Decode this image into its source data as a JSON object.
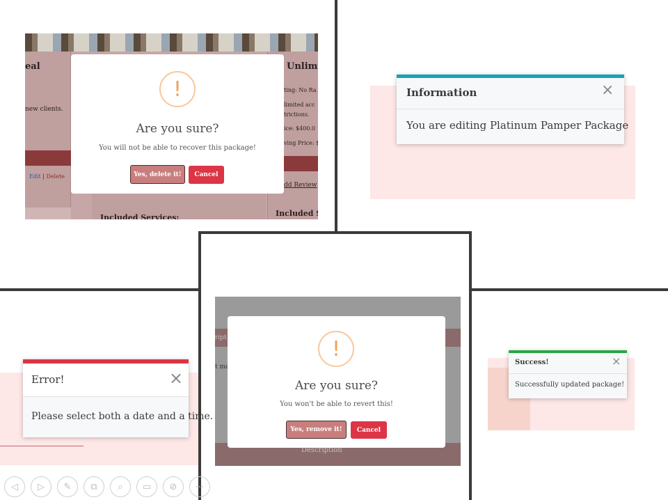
{
  "panel1": {
    "bg_left_heading": "eal",
    "bg_left_text": "new clients.",
    "bg_left_links": {
      "edit": "Edit",
      "sep": "|",
      "delete": "Delete"
    },
    "bg_right_heading": "Unlimi",
    "bg_right_lines": [
      "ting: No Ra",
      "limited acc",
      "trictions.",
      "ice: $400.0",
      "ving Price: $"
    ],
    "bg_right_link": "dd Review",
    "bg_right_section": "Included Se",
    "bg_middle_section": "Included Services:",
    "dialog": {
      "icon": "!",
      "title": "Are you sure?",
      "text": "You will not be able to recover this package!",
      "confirm": "Yes, delete it!",
      "cancel": "Cancel"
    }
  },
  "toast_info": {
    "title": "Information",
    "message": "You are editing Platinum Pamper Package",
    "close": "×",
    "accent": "#17a2b8"
  },
  "toast_error": {
    "title": "Error!",
    "message": "Please select both a date and a time.",
    "close": "×",
    "accent": "#dc3545"
  },
  "toast_success": {
    "title": "Success!",
    "message": "Successfully updated package!",
    "close": "×",
    "accent": "#28a745"
  },
  "panel4": {
    "bg_text_1": "ript",
    "bg_text_2": "t ma",
    "bg_description": "Description",
    "dialog": {
      "icon": "!",
      "title": "Are you sure?",
      "text": "You won't be able to revert this!",
      "confirm": "Yes, remove it!",
      "cancel": "Cancel"
    }
  },
  "toolbar": {
    "items": [
      {
        "icon": "previous-icon",
        "glyph": "◁"
      },
      {
        "icon": "next-icon",
        "glyph": "▷"
      },
      {
        "icon": "pen-icon",
        "glyph": "✎"
      },
      {
        "icon": "copy-icon",
        "glyph": "⧉"
      },
      {
        "icon": "zoom-icon",
        "glyph": "⌕"
      },
      {
        "icon": "subtitles-icon",
        "glyph": "▭"
      },
      {
        "icon": "video-off-icon",
        "glyph": "⊘"
      },
      {
        "icon": "more-icon",
        "glyph": "⋯"
      }
    ]
  }
}
